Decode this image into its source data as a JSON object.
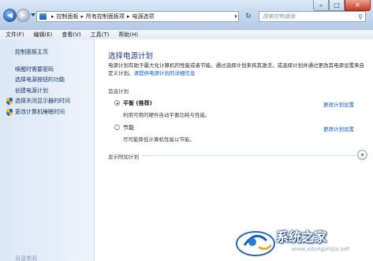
{
  "window": {
    "breadcrumbs": [
      "控制面板",
      "所有控制面板项",
      "电源选项"
    ],
    "search_placeholder": "搜索控制面板"
  },
  "menu": [
    "文件(F)",
    "编辑(E)",
    "查看(V)",
    "工具(T)",
    "帮助(H)"
  ],
  "sidebar": {
    "home": "控制面板主页",
    "links": [
      "唤醒时需要密码",
      "选择电源按钮的功能",
      "创建电源计划",
      "选择关闭显示器的时间",
      "更改计算机睡眠时间"
    ],
    "see_also": "另请参阅"
  },
  "main": {
    "title": "选择电源计划",
    "intro": "电源计划有助于最大化计算机的性能或者节能。通过选择计划来将其激活，或选择计划并通过更改其电源设置来自定义计划。",
    "intro_link": "请提供电源计划的详细信息",
    "section_label": "首选计划",
    "plans": [
      {
        "name": "平衡 (推荐)",
        "description": "利用可用的硬件自动平衡功耗与性能。",
        "change_link": "更改计划设置",
        "selected": true
      },
      {
        "name": "节能",
        "description": "尽可能降低计算机性能以节能。",
        "change_link": "更改计划设置",
        "selected": false
      }
    ],
    "show_more": "显示附加计划"
  },
  "watermark": {
    "text": "系统之家",
    "url": "www.xitongzhijia.net"
  },
  "colors": {
    "title_blue": "#1e3a8a",
    "link_blue": "#0b5bd3",
    "close_red": "#c63a23"
  }
}
